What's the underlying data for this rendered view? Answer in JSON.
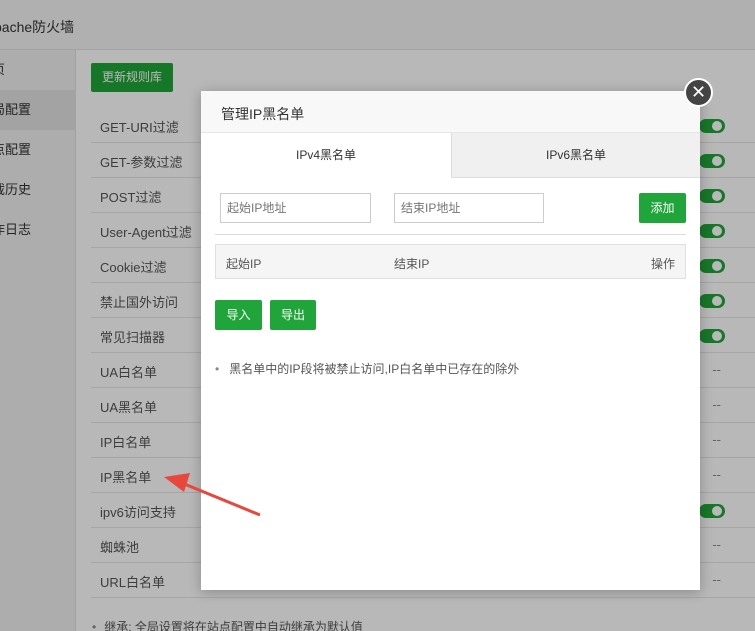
{
  "window": {
    "title": "pache防火墙"
  },
  "sidebar": {
    "items": [
      {
        "label": "页"
      },
      {
        "label": "局配置"
      },
      {
        "label": "点配置"
      },
      {
        "label": "截历史"
      },
      {
        "label": "作日志"
      }
    ]
  },
  "main": {
    "update_button": "更新规则库",
    "rules": [
      {
        "name": "GET-URI过滤",
        "state": "on"
      },
      {
        "name": "GET-参数过滤",
        "state": "on"
      },
      {
        "name": "POST过滤",
        "state": "on"
      },
      {
        "name": "User-Agent过滤",
        "state": "on"
      },
      {
        "name": "Cookie过滤",
        "state": "on"
      },
      {
        "name": "禁止国外访问",
        "state": "on"
      },
      {
        "name": "常见扫描器",
        "state": "on"
      },
      {
        "name": "UA白名单",
        "state": "--"
      },
      {
        "name": "UA黑名单",
        "state": "--"
      },
      {
        "name": "IP白名单",
        "state": "--"
      },
      {
        "name": "IP黑名单",
        "state": "--"
      },
      {
        "name": "ipv6访问支持",
        "state": "on"
      },
      {
        "name": "蜘蛛池",
        "state": "--"
      },
      {
        "name": "URL白名单",
        "state": "--"
      }
    ],
    "footnote": "继承: 全局设置将在站点配置中自动继承为默认值"
  },
  "modal": {
    "title": "管理IP黑名单",
    "tabs": [
      {
        "label": "IPv4黑名单",
        "active": true
      },
      {
        "label": "IPv6黑名单",
        "active": false
      }
    ],
    "start_ip_placeholder": "起始IP地址",
    "end_ip_placeholder": "结束IP地址",
    "add_button": "添加",
    "table_headers": [
      "起始IP",
      "结束IP",
      "操作"
    ],
    "import_button": "导入",
    "export_button": "导出",
    "tip": "黑名单中的IP段将被禁止访问,IP白名单中已存在的除外",
    "close_icon": "close-icon"
  },
  "colors": {
    "accent": "#20a53a",
    "arrow": "#e8473b"
  }
}
